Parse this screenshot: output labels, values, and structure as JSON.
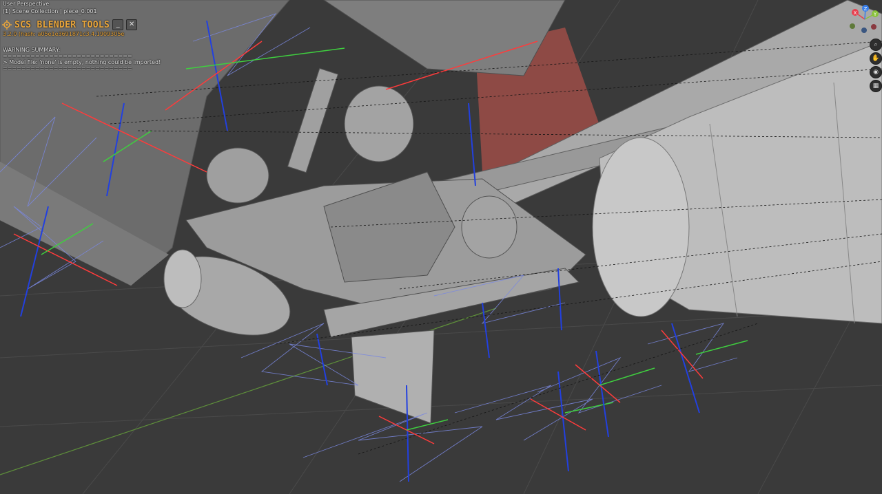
{
  "viewport": {
    "view_name": "User Perspective",
    "collection_path": "(1) Scene Collection | piece_0.001",
    "background_color": "#3a3a3a"
  },
  "scs_panel": {
    "logo_icon": "scs-logo-icon",
    "title": "SCS BLENDER TOOLS",
    "minimize_label": "_",
    "close_label": "✕",
    "version": "3.2.0 (hash: a05e1e3691871c3.4.1909305e",
    "warning_title": "WARNING SUMMARY:",
    "separator": "============================",
    "warning_line": "> Model file: 'none' is empty, nothing could be imported!",
    "accent_color": "#e9a53a"
  },
  "nav_gizmo": {
    "x_label": "X",
    "y_label": "Y",
    "z_label": "Z",
    "x_color": "#e8404f",
    "y_color": "#8ac23b",
    "z_color": "#3a7fe8"
  },
  "nav_tools": [
    {
      "name": "zoom-icon",
      "glyph": "⌕"
    },
    {
      "name": "hand-pan-icon",
      "glyph": "✋"
    },
    {
      "name": "camera-view-icon",
      "glyph": "◉"
    },
    {
      "name": "ortho-grid-icon",
      "glyph": "▦"
    }
  ],
  "scene_colors": {
    "model_gray": "#8f8f8f",
    "model_light": "#b4b4b4",
    "model_dark": "#5f5f5f",
    "red_panel": "#8e4a45",
    "axis_red": "#ff3b3b",
    "axis_green": "#3fcf3f",
    "axis_blue": "#2240e0",
    "wire_blue": "#7a88e0"
  }
}
